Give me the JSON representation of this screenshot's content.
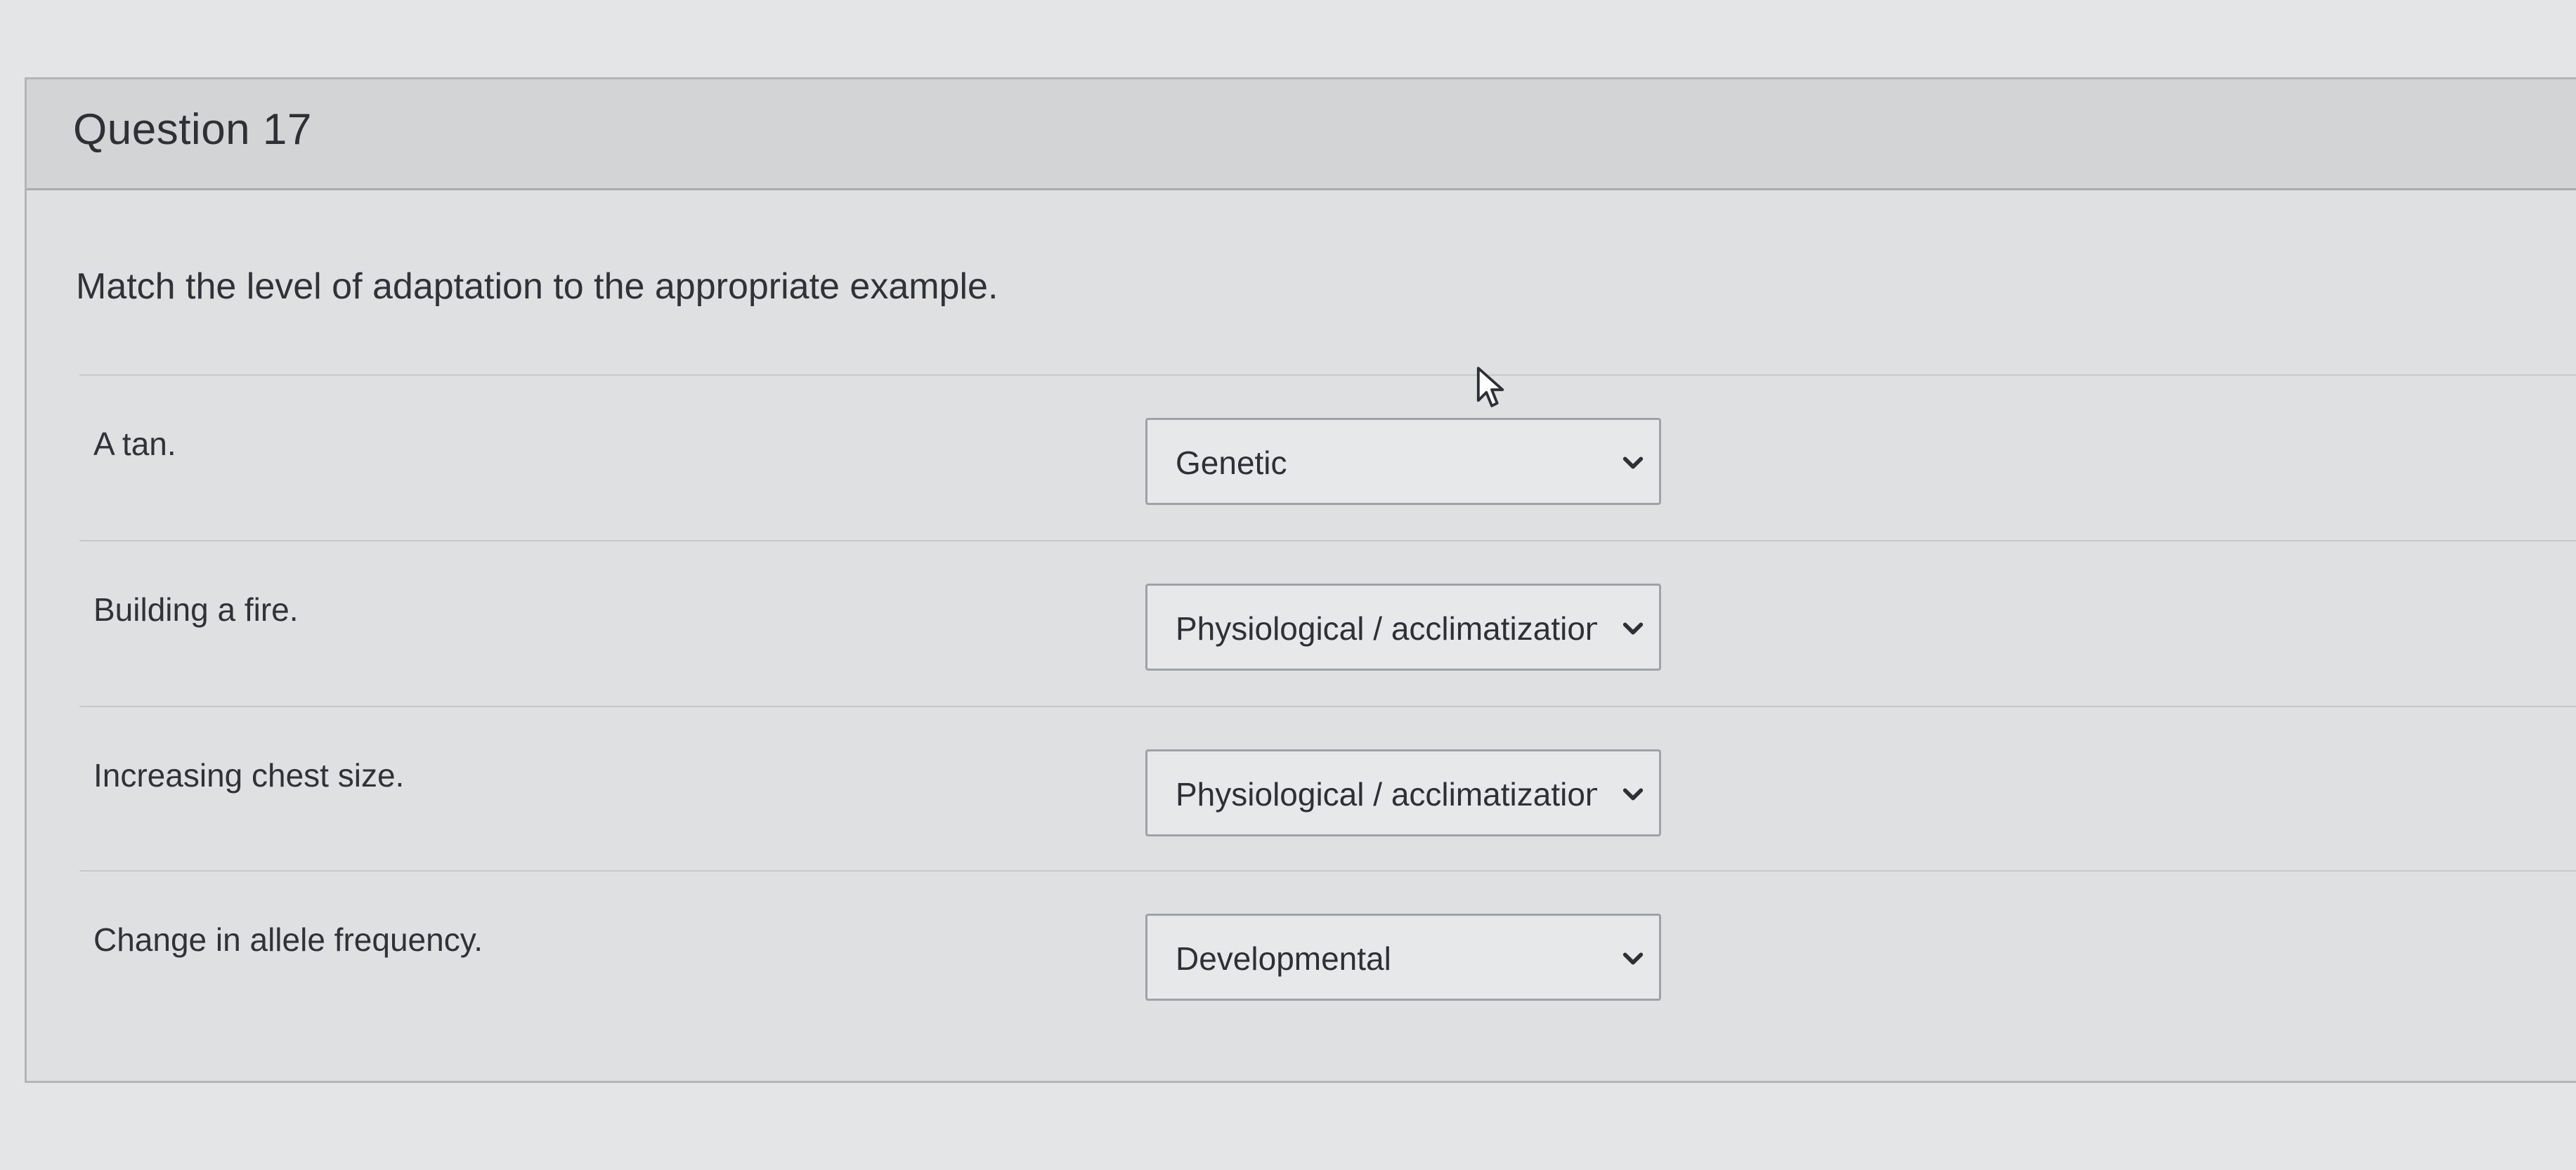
{
  "question": {
    "title": "Question 17",
    "prompt": "Match the level of adaptation to the appropriate example."
  },
  "matches": [
    {
      "prompt": "A tan.",
      "selected": "Genetic"
    },
    {
      "prompt": "Building a fire.",
      "selected": "Physiological / acclimatization"
    },
    {
      "prompt": "Increasing chest size.",
      "selected": "Physiological / acclimatization"
    },
    {
      "prompt": "Change in allele frequency.",
      "selected": "Developmental"
    }
  ],
  "icons": {
    "dropdown": "chevron-down-icon",
    "cursor": "mouse-pointer-icon"
  },
  "colors": {
    "background": "#e4e5e6",
    "header": "#d3d4d5",
    "text": "#2d3034",
    "border": "#9fa2a5"
  }
}
